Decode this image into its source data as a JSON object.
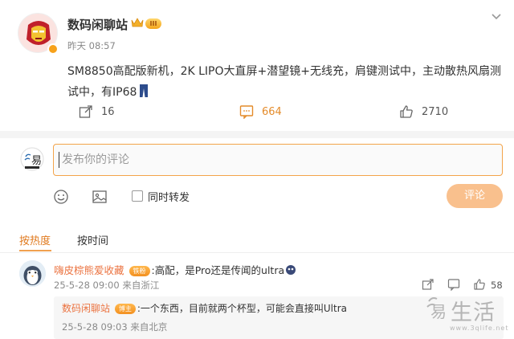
{
  "post": {
    "author": "数码闲聊站",
    "level_badge": "III",
    "time": "昨天 08:57",
    "text": "SM8850高配版新机，2K LIPO大直屏+潜望镜+无线充，肩键测试中，主动散热风扇测试中，有IP68",
    "actions": {
      "share_count": "16",
      "comment_count": "664",
      "like_count": "2710"
    }
  },
  "composer": {
    "placeholder": "发布你的评论",
    "repost_label": "同时转发",
    "submit_label": "评论"
  },
  "sort_tabs": {
    "hot": "按热度",
    "time": "按时间"
  },
  "comment": {
    "user": "嗨皮棕熊爱收藏",
    "badge": "铁粉",
    "text": ":高配，是Pro还是传闻的ultra",
    "meta": "25-5-28 09:00 来自浙江",
    "like_count": "58"
  },
  "reply": {
    "user": "数码闲聊站",
    "badge": "博主",
    "text": ":一个东西，目前就两个杯型，可能会直接叫Ultra",
    "meta": "25-5-28 09:03 来自北京"
  },
  "watermark": {
    "text": "生活",
    "url": "www.3qlife.net"
  },
  "colors": {
    "accent": "#eb7340",
    "active_tab": "#e07a1f",
    "comment_count": "#e48b2a",
    "submit_disabled": "#f9c08d"
  }
}
